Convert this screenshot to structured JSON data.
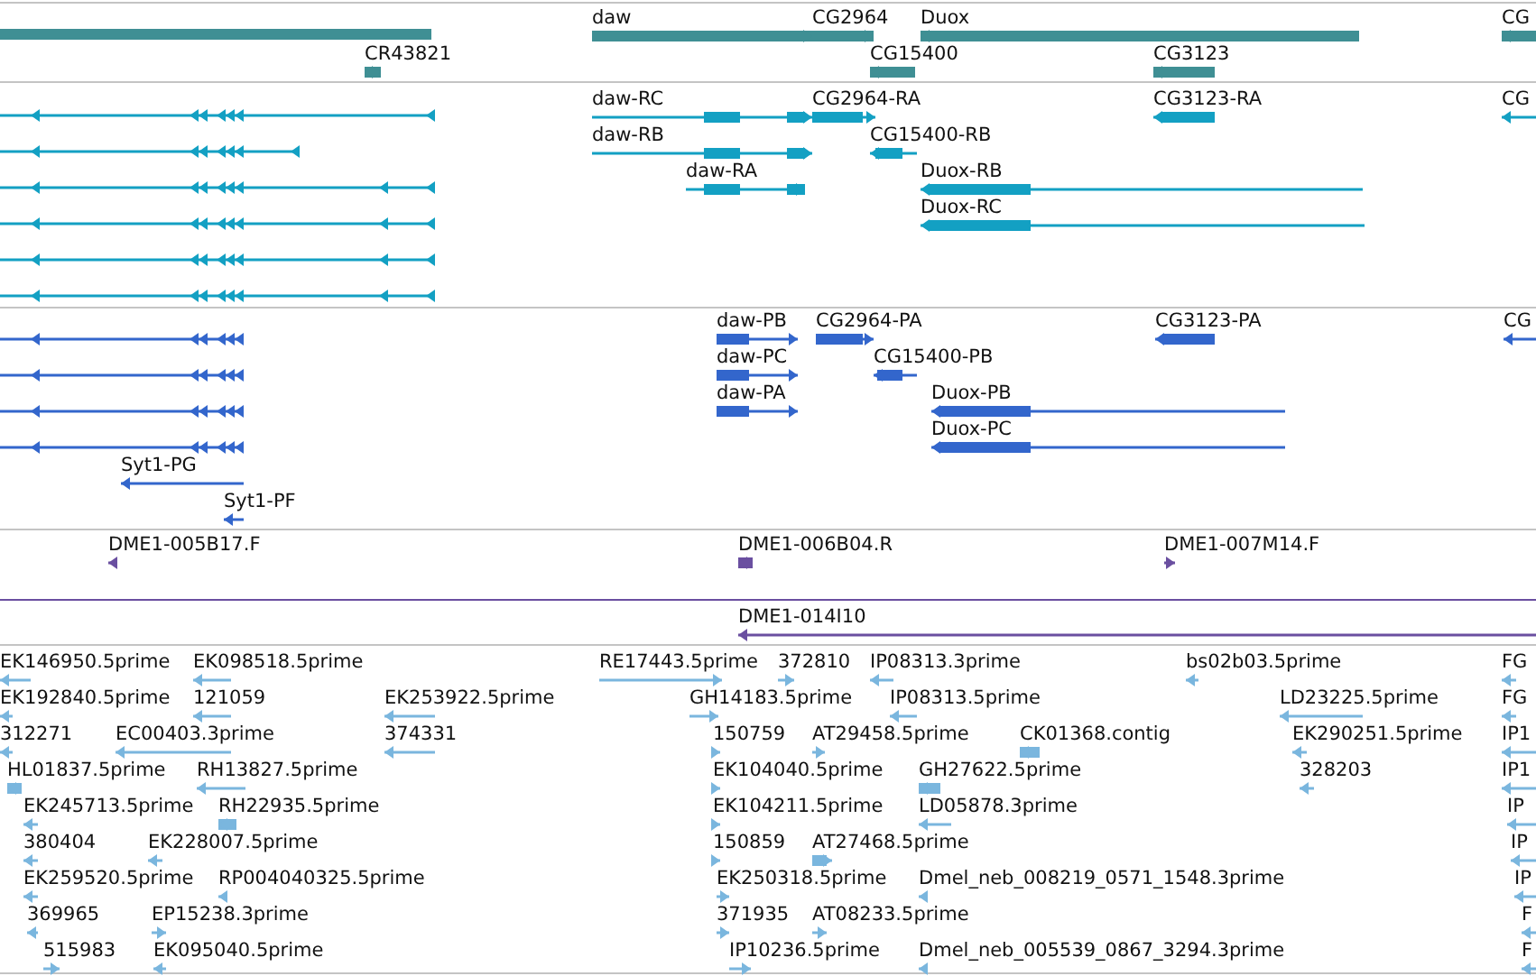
{
  "tracks": [
    {
      "kind": "genes",
      "features": [
        {
          "label": "daw",
          "reverse": false
        },
        {
          "label": "CG2964",
          "reverse": false
        },
        {
          "label": "Duox",
          "reverse": true
        },
        {
          "label": "CG",
          "reverse": true
        },
        {
          "label": "CR43821",
          "reverse": false
        },
        {
          "label": "CG15400",
          "reverse": true
        },
        {
          "label": "CG3123",
          "reverse": true
        }
      ]
    },
    {
      "kind": "transcripts",
      "features": [
        {
          "label": "daw-RC",
          "reverse": false
        },
        {
          "label": "daw-RB",
          "reverse": false
        },
        {
          "label": "daw-RA",
          "reverse": false
        },
        {
          "label": "CG2964-RA",
          "reverse": false
        },
        {
          "label": "CG15400-RB",
          "reverse": true
        },
        {
          "label": "Duox-RB",
          "reverse": true
        },
        {
          "label": "Duox-RC",
          "reverse": true
        },
        {
          "label": "CG3123-RA",
          "reverse": true
        },
        {
          "label": "CG",
          "reverse": true
        }
      ]
    },
    {
      "kind": "proteins",
      "features": [
        {
          "label": "daw-PB",
          "reverse": false
        },
        {
          "label": "daw-PC",
          "reverse": false
        },
        {
          "label": "daw-PA",
          "reverse": false
        },
        {
          "label": "CG2964-PA",
          "reverse": false
        },
        {
          "label": "CG15400-PB",
          "reverse": true
        },
        {
          "label": "Duox-PB",
          "reverse": true
        },
        {
          "label": "Duox-PC",
          "reverse": true
        },
        {
          "label": "CG3123-PA",
          "reverse": true
        },
        {
          "label": "CG",
          "reverse": true
        },
        {
          "label": "Syt1-PG",
          "reverse": true
        },
        {
          "label": "Syt1-PF",
          "reverse": true
        }
      ]
    },
    {
      "kind": "clone_ends",
      "features": [
        {
          "label": "DME1-005B17.F",
          "reverse": true
        },
        {
          "label": "DME1-006B04.R",
          "reverse": true
        },
        {
          "label": "DME1-007M14.F",
          "reverse": false
        }
      ]
    },
    {
      "kind": "clones",
      "features": [
        {
          "label": "DME1-014I10",
          "reverse": true
        }
      ]
    },
    {
      "kind": "ests",
      "features": [
        {
          "label": "EK146950.5prime",
          "reverse": true
        },
        {
          "label": "EK098518.5prime",
          "reverse": true
        },
        {
          "label": "RE17443.5prime",
          "reverse": false
        },
        {
          "label": "372810",
          "reverse": false
        },
        {
          "label": "IP08313.3prime",
          "reverse": true
        },
        {
          "label": "bs02b03.5prime",
          "reverse": true
        },
        {
          "label": "FG",
          "reverse": true
        },
        {
          "label": "EK192840.5prime",
          "reverse": true
        },
        {
          "label": "121059",
          "reverse": true
        },
        {
          "label": "EK253922.5prime",
          "reverse": true
        },
        {
          "label": "GH14183.5prime",
          "reverse": false
        },
        {
          "label": "IP08313.5prime",
          "reverse": true
        },
        {
          "label": "LD23225.5prime",
          "reverse": true
        },
        {
          "label": "FG",
          "reverse": true
        },
        {
          "label": "312271",
          "reverse": true
        },
        {
          "label": "EC00403.3prime",
          "reverse": true
        },
        {
          "label": "374331",
          "reverse": true
        },
        {
          "label": "150759",
          "reverse": false
        },
        {
          "label": "AT29458.5prime",
          "reverse": false
        },
        {
          "label": "CK01368.contig",
          "reverse": true
        },
        {
          "label": "EK290251.5prime",
          "reverse": true
        },
        {
          "label": "IP1",
          "reverse": true
        },
        {
          "label": "HL01837.5prime",
          "reverse": true
        },
        {
          "label": "RH13827.5prime",
          "reverse": true
        },
        {
          "label": "EK104040.5prime",
          "reverse": false
        },
        {
          "label": "GH27622.5prime",
          "reverse": true
        },
        {
          "label": "328203",
          "reverse": true
        },
        {
          "label": "IP1",
          "reverse": true
        },
        {
          "label": "EK245713.5prime",
          "reverse": true
        },
        {
          "label": "RH22935.5prime",
          "reverse": true
        },
        {
          "label": "EK104211.5prime",
          "reverse": false
        },
        {
          "label": "LD05878.3prime",
          "reverse": true
        },
        {
          "label": "IP",
          "reverse": true
        },
        {
          "label": "380404",
          "reverse": true
        },
        {
          "label": "EK228007.5prime",
          "reverse": true
        },
        {
          "label": "150859",
          "reverse": false
        },
        {
          "label": "AT27468.5prime",
          "reverse": false
        },
        {
          "label": "IP",
          "reverse": true
        },
        {
          "label": "EK259520.5prime",
          "reverse": true
        },
        {
          "label": "RP004040325.5prime",
          "reverse": true
        },
        {
          "label": "EK250318.5prime",
          "reverse": false
        },
        {
          "label": "Dmel_neb_008219_0571_1548.3prime",
          "reverse": true
        },
        {
          "label": "IP",
          "reverse": true
        },
        {
          "label": "369965",
          "reverse": true
        },
        {
          "label": "EP15238.3prime",
          "reverse": false
        },
        {
          "label": "371935",
          "reverse": false
        },
        {
          "label": "AT08233.5prime",
          "reverse": false
        },
        {
          "label": "F",
          "reverse": true
        },
        {
          "label": "515983",
          "reverse": false
        },
        {
          "label": "EK095040.5prime",
          "reverse": true
        },
        {
          "label": "IP10236.5prime",
          "reverse": false
        },
        {
          "label": "Dmel_neb_005539_0867_3294.3prime",
          "reverse": true
        },
        {
          "label": "F",
          "reverse": true
        }
      ]
    }
  ]
}
